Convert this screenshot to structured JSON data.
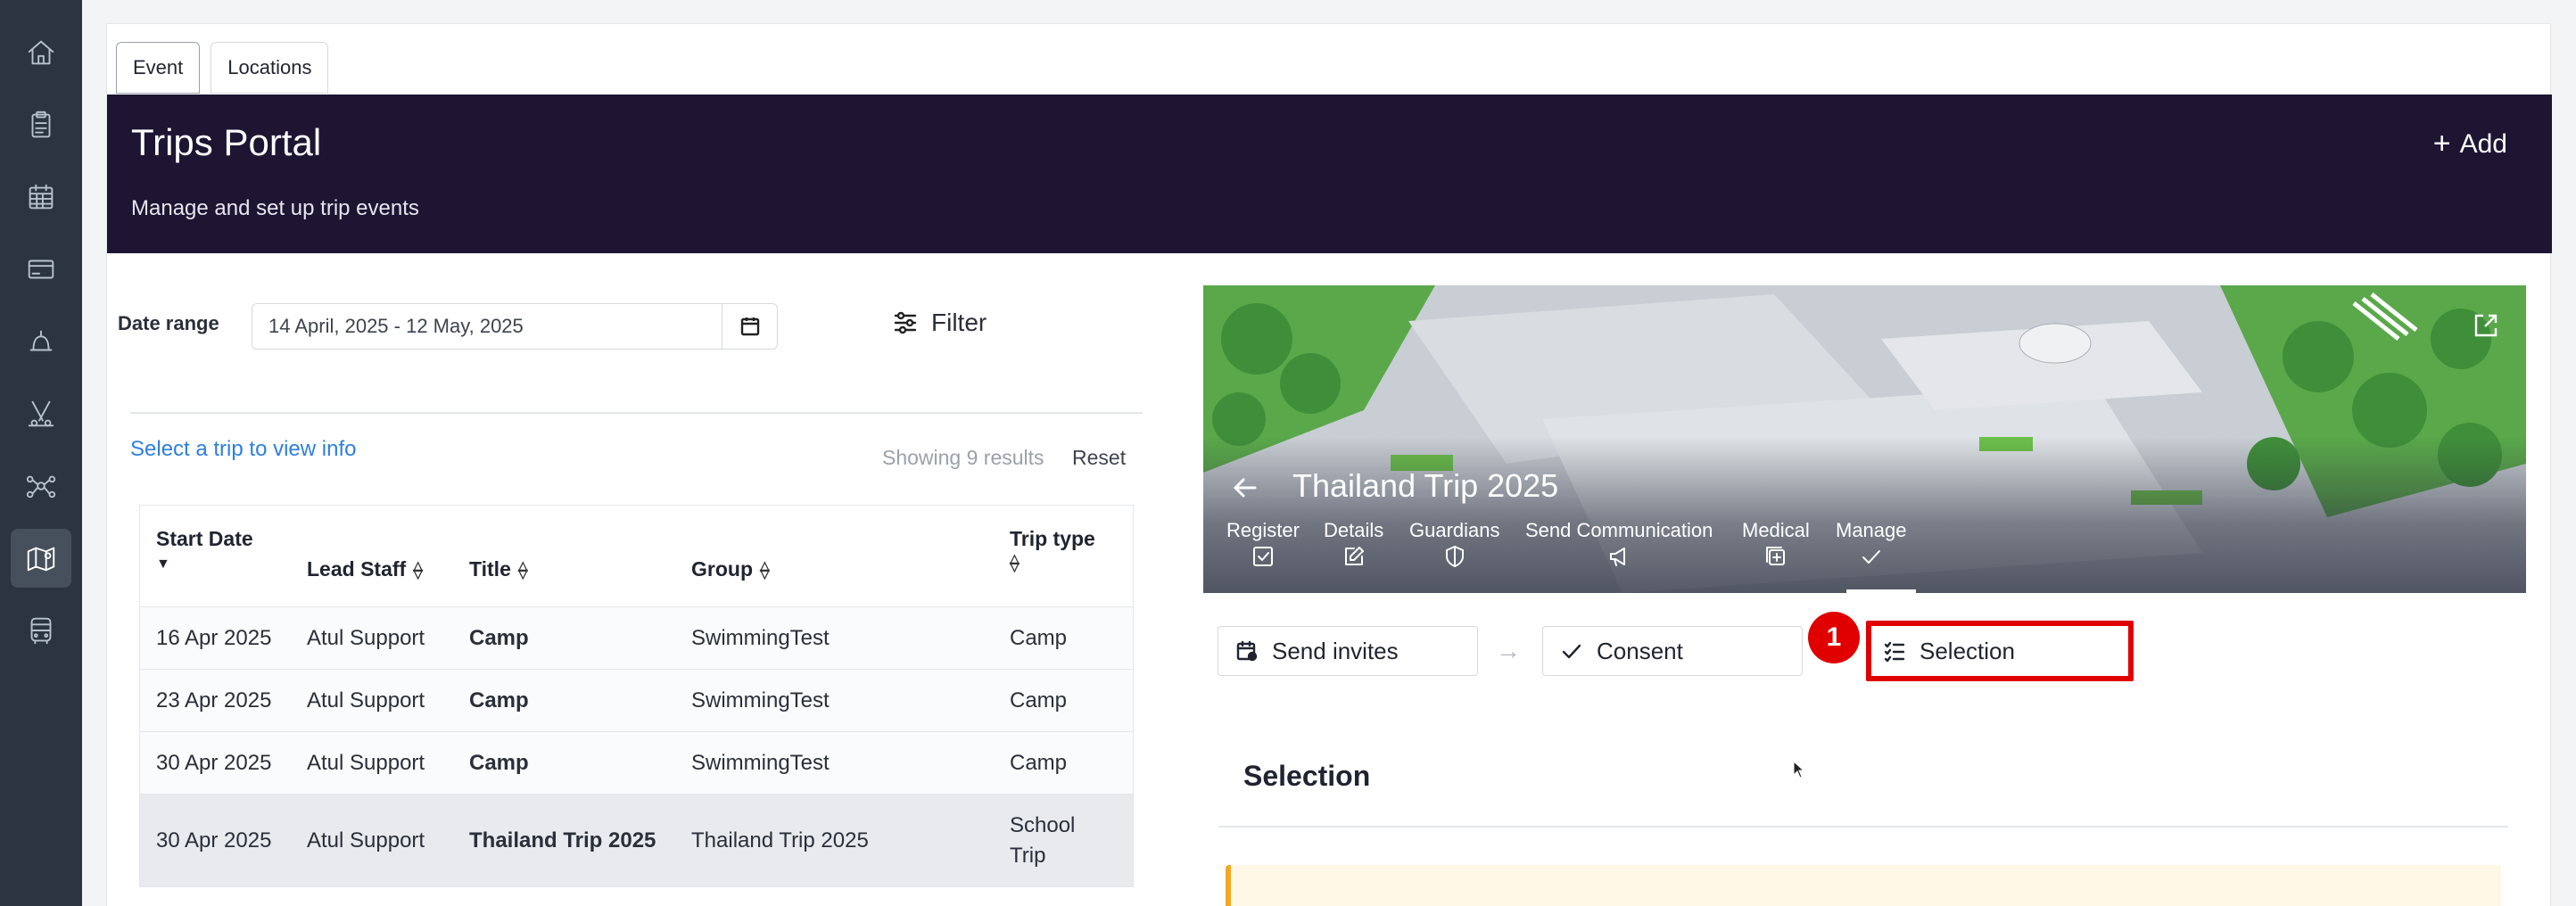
{
  "sidebar": {
    "items": [
      {
        "icon": "home-icon"
      },
      {
        "icon": "clipboard-icon"
      },
      {
        "icon": "calendar-icon"
      },
      {
        "icon": "card-icon"
      },
      {
        "icon": "bell-icon"
      },
      {
        "icon": "sports-icon"
      },
      {
        "icon": "network-icon"
      },
      {
        "icon": "map-icon",
        "active": true
      },
      {
        "icon": "bus-icon"
      }
    ]
  },
  "tabs": [
    "Event",
    "Locations"
  ],
  "banner": {
    "title": "Trips Portal",
    "subtitle": "Manage and set up trip events",
    "add_label": "Add"
  },
  "filters": {
    "date_label": "Date range",
    "date_value": "14 April, 2025 - 12 May, 2025",
    "filter_label": "Filter"
  },
  "list": {
    "hint": "Select a trip to view info",
    "showing": "Showing 9 results",
    "reset": "Reset"
  },
  "table": {
    "headers": [
      "Start Date",
      "Lead Staff",
      "Title",
      "Group",
      "Trip type"
    ],
    "rows": [
      {
        "start": "16 Apr 2025",
        "lead": "Atul Support",
        "title": "Camp",
        "group": "SwimmingTest",
        "type": "Camp"
      },
      {
        "start": "23 Apr 2025",
        "lead": "Atul Support",
        "title": "Camp",
        "group": "SwimmingTest",
        "type": "Camp"
      },
      {
        "start": "30 Apr 2025",
        "lead": "Atul Support",
        "title": "Camp",
        "group": "SwimmingTest",
        "type": "Camp"
      },
      {
        "start": "30 Apr 2025",
        "lead": "Atul Support",
        "title": "Thailand Trip 2025",
        "group": "Thailand Trip 2025",
        "type": "School Trip"
      }
    ]
  },
  "trip": {
    "title": "Thailand Trip 2025",
    "actions": [
      "Register",
      "Details",
      "Guardians",
      "Send Communication",
      "Medical",
      "Manage"
    ]
  },
  "steps": {
    "send_invites": "Send invites",
    "consent": "Consent",
    "selection": "Selection",
    "badge": "1"
  },
  "section": {
    "title": "Selection"
  },
  "colors": {
    "banner": "#1d1532",
    "sidebar": "#2b3440",
    "link": "#2d7fe0",
    "highlight": "#e00000"
  }
}
